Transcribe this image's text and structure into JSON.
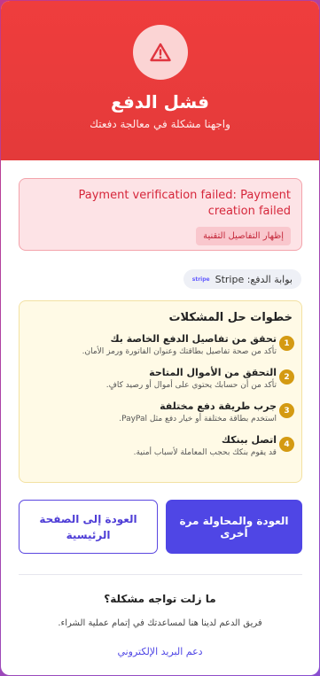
{
  "header": {
    "icon": "warning-triangle-icon",
    "title": "فشل الدفع",
    "subtitle": "واجهنا مشكلة في معالجة دفعتك",
    "color": "#ef3d3d"
  },
  "error": {
    "message": "Payment verification failed: Payment creation failed",
    "details_button": "إظهار التفاصيل التقنية"
  },
  "gateway": {
    "label": "بوابة الدفع: Stripe",
    "badge": "stripe"
  },
  "troubleshooting": {
    "title": "خطوات حل المشكلات",
    "steps": [
      {
        "num": "1",
        "title": "تحقق من تفاصيل الدفع الخاصة بك",
        "desc": "تأكد من صحة تفاصيل بطاقتك وعنوان الفاتورة ورمز الأمان."
      },
      {
        "num": "2",
        "title": "التحقق من الأموال المتاحة",
        "desc": "تأكد من أن حسابك يحتوي على أموال أو رصيد كافٍ."
      },
      {
        "num": "3",
        "title": "جرب طريقة دفع مختلفة",
        "desc": "استخدم بطاقة مختلفة أو خيار دفع مثل PayPal."
      },
      {
        "num": "4",
        "title": "اتصل ببنكك",
        "desc": "قد يقوم بنكك بحجب المعاملة لأسباب أمنية."
      }
    ]
  },
  "actions": {
    "retry": "العودة والمحاولة مرة أخرى",
    "home": "العودة إلى الصفحة الرئيسية"
  },
  "help": {
    "title": "ما زلت تواجه مشكلة؟",
    "desc": "فريق الدعم لدينا هنا لمساعدتك في إتمام عملية الشراء.",
    "link": "دعم البريد الإلكتروني"
  }
}
